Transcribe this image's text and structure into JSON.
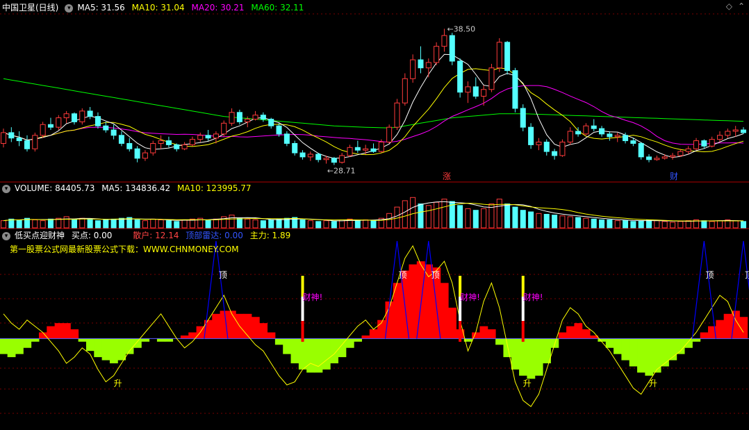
{
  "colors": {
    "background": "#000000",
    "up": "#ff3b3b",
    "down": "#54ffff",
    "ma5": "#ffffff",
    "ma10": "#ffff00",
    "ma20": "#ff00ff",
    "ma60": "#00ff00",
    "grid": "#7a0000",
    "pos_fill": "#ff0000",
    "neg_fill": "#99ff00",
    "yellow_line": "#ffff00",
    "blue_line": "#0000ff"
  },
  "price_panel": {
    "stock": "中国卫星(日线)",
    "ma5": "MA5: 31.56",
    "ma10": "MA10: 31.04",
    "ma20": "MA20: 30.21",
    "ma60": "MA60: 32.11",
    "high_label": "38.50",
    "low_label": "28.71",
    "zhang_marker": "涨",
    "cai_marker": "财",
    "toolbar_icons": [
      "diamond-icon",
      "collapse-icon"
    ]
  },
  "volume_panel": {
    "volume": "VOLUME: 84405.73",
    "ma5": "MA5: 134836.42",
    "ma10": "MA10: 123995.77"
  },
  "indicator_panel": {
    "name": "低买点迎财神",
    "buy": "买点: 0.00",
    "retail": "散户: 12.14",
    "radar": "顶部雷达: 0.00",
    "main_force": "主力: 1.89",
    "banner": "第一股票公式网最新股票公式下载：WWW.CHNMONEY.COM",
    "top_labels": [
      "顶",
      "顶",
      "顶",
      "顶",
      "顶",
      "顶"
    ],
    "caishen_labels": [
      "财神!",
      "财神!",
      "财神!"
    ],
    "sheng_labels": [
      "升",
      "升",
      "升"
    ]
  },
  "chart_data": {
    "type": "line",
    "candles_ohlc": [
      [
        30.0,
        31.1,
        29.7,
        30.8
      ],
      [
        30.8,
        31.2,
        30.1,
        30.4
      ],
      [
        30.4,
        30.9,
        29.8,
        30.2
      ],
      [
        30.2,
        30.6,
        29.4,
        29.6
      ],
      [
        29.6,
        30.8,
        29.4,
        30.6
      ],
      [
        30.6,
        31.6,
        30.4,
        31.4
      ],
      [
        31.4,
        31.9,
        31.0,
        31.2
      ],
      [
        31.2,
        32.1,
        31.0,
        31.9
      ],
      [
        31.9,
        32.4,
        31.5,
        32.2
      ],
      [
        32.2,
        32.3,
        31.4,
        31.6
      ],
      [
        31.6,
        32.6,
        31.4,
        32.4
      ],
      [
        32.4,
        32.7,
        31.8,
        32.0
      ],
      [
        32.0,
        32.3,
        31.1,
        31.3
      ],
      [
        31.3,
        31.6,
        30.8,
        31.0
      ],
      [
        31.0,
        31.4,
        30.3,
        30.6
      ],
      [
        30.6,
        30.9,
        29.8,
        30.0
      ],
      [
        30.0,
        30.4,
        29.4,
        29.6
      ],
      [
        29.6,
        29.8,
        28.6,
        28.9
      ],
      [
        28.9,
        29.5,
        28.7,
        29.3
      ],
      [
        29.3,
        30.2,
        29.1,
        30.0
      ],
      [
        30.0,
        30.6,
        29.6,
        30.2
      ],
      [
        30.2,
        30.5,
        29.7,
        29.9
      ],
      [
        29.9,
        30.0,
        29.4,
        29.6
      ],
      [
        29.6,
        30.1,
        29.5,
        29.9
      ],
      [
        29.9,
        30.5,
        29.8,
        30.3
      ],
      [
        30.3,
        30.8,
        30.1,
        30.6
      ],
      [
        30.6,
        31.0,
        30.2,
        30.4
      ],
      [
        30.4,
        30.9,
        30.0,
        30.7
      ],
      [
        30.7,
        31.7,
        30.5,
        31.5
      ],
      [
        31.5,
        32.6,
        31.3,
        32.3
      ],
      [
        32.3,
        32.5,
        31.4,
        31.6
      ],
      [
        31.6,
        32.0,
        31.2,
        31.8
      ],
      [
        31.8,
        32.4,
        31.7,
        32.1
      ],
      [
        32.1,
        32.3,
        31.6,
        31.8
      ],
      [
        31.8,
        31.9,
        31.1,
        31.3
      ],
      [
        31.3,
        31.5,
        30.5,
        30.7
      ],
      [
        30.7,
        30.9,
        29.8,
        30.0
      ],
      [
        30.0,
        30.2,
        29.1,
        29.3
      ],
      [
        29.3,
        29.5,
        28.8,
        29.0
      ],
      [
        29.0,
        29.4,
        28.7,
        29.2
      ],
      [
        29.2,
        29.3,
        28.6,
        28.8
      ],
      [
        28.8,
        29.1,
        28.5,
        28.9
      ],
      [
        28.9,
        29.0,
        28.4,
        28.6
      ],
      [
        28.6,
        29.3,
        28.5,
        29.1
      ],
      [
        29.1,
        29.9,
        29.0,
        29.7
      ],
      [
        29.7,
        30.2,
        29.3,
        29.5
      ],
      [
        29.5,
        29.9,
        29.2,
        29.6
      ],
      [
        29.6,
        30.0,
        29.3,
        29.4
      ],
      [
        29.4,
        30.3,
        29.3,
        30.1
      ],
      [
        30.1,
        31.4,
        30.0,
        31.2
      ],
      [
        31.2,
        33.3,
        31.0,
        33.0
      ],
      [
        33.0,
        35.2,
        32.8,
        34.8
      ],
      [
        34.8,
        36.6,
        34.5,
        36.2
      ],
      [
        36.2,
        37.2,
        35.2,
        35.6
      ],
      [
        35.6,
        36.3,
        34.9,
        36.0
      ],
      [
        36.0,
        37.5,
        35.8,
        37.2
      ],
      [
        37.2,
        38.5,
        36.8,
        38.0
      ],
      [
        38.0,
        38.2,
        35.8,
        36.1
      ],
      [
        36.1,
        36.3,
        33.4,
        33.8
      ],
      [
        33.8,
        34.6,
        33.0,
        34.2
      ],
      [
        34.2,
        34.9,
        33.3,
        33.5
      ],
      [
        33.5,
        34.3,
        32.8,
        34.0
      ],
      [
        34.0,
        35.9,
        33.8,
        35.6
      ],
      [
        35.6,
        37.8,
        35.3,
        37.5
      ],
      [
        37.5,
        37.6,
        35.1,
        35.4
      ],
      [
        35.4,
        35.6,
        32.3,
        32.6
      ],
      [
        32.6,
        32.9,
        30.9,
        31.2
      ],
      [
        31.2,
        31.5,
        29.6,
        29.9
      ],
      [
        29.9,
        30.4,
        29.5,
        30.1
      ],
      [
        30.1,
        30.3,
        29.1,
        29.4
      ],
      [
        29.4,
        29.6,
        28.8,
        29.1
      ],
      [
        29.1,
        30.3,
        29.0,
        30.1
      ],
      [
        30.1,
        31.2,
        29.9,
        30.9
      ],
      [
        30.9,
        31.2,
        30.5,
        30.7
      ],
      [
        30.7,
        31.5,
        30.6,
        31.3
      ],
      [
        31.3,
        31.8,
        30.9,
        31.1
      ],
      [
        31.1,
        31.3,
        30.5,
        30.7
      ],
      [
        30.7,
        30.9,
        30.2,
        30.5
      ],
      [
        30.5,
        30.8,
        30.1,
        30.6
      ],
      [
        30.6,
        30.8,
        30.0,
        30.2
      ],
      [
        30.2,
        30.4,
        29.8,
        30.0
      ],
      [
        30.0,
        30.1,
        28.8,
        29.0
      ],
      [
        29.0,
        29.2,
        28.6,
        28.8
      ],
      [
        28.8,
        29.1,
        28.71,
        28.9
      ],
      [
        28.9,
        29.2,
        28.8,
        29.0
      ],
      [
        29.0,
        29.3,
        28.8,
        29.1
      ],
      [
        29.1,
        29.6,
        29.0,
        29.4
      ],
      [
        29.4,
        29.8,
        29.2,
        29.6
      ],
      [
        29.6,
        30.4,
        29.5,
        30.2
      ],
      [
        30.2,
        30.3,
        29.6,
        29.8
      ],
      [
        29.8,
        30.5,
        29.7,
        30.3
      ],
      [
        30.3,
        30.9,
        30.1,
        30.6
      ],
      [
        30.6,
        31.1,
        30.4,
        30.9
      ],
      [
        30.9,
        31.3,
        30.5,
        31.0
      ],
      [
        31.0,
        31.2,
        30.7,
        30.8
      ]
    ],
    "ma60_line": [
      34.8,
      34.7,
      34.6,
      34.5,
      34.4,
      34.3,
      34.2,
      34.1,
      34.0,
      33.9,
      33.8,
      33.7,
      33.6,
      33.5,
      33.4,
      33.3,
      33.2,
      33.1,
      33.0,
      32.9,
      32.8,
      32.7,
      32.6,
      32.5,
      32.4,
      32.3,
      32.2,
      32.1,
      32.0,
      31.95,
      31.9,
      31.85,
      31.8,
      31.75,
      31.7,
      31.65,
      31.6,
      31.55,
      31.5,
      31.45,
      31.4,
      31.35,
      31.3,
      31.27,
      31.25,
      31.22,
      31.2,
      31.18,
      31.16,
      31.15,
      31.2,
      31.3,
      31.4,
      31.5,
      31.6,
      31.7,
      31.8,
      31.9,
      31.95,
      32.0,
      32.05,
      32.1,
      32.15,
      32.2,
      32.2,
      32.2,
      32.2,
      32.18,
      32.16,
      32.14,
      32.12,
      32.1,
      32.08,
      32.06,
      32.04,
      32.02,
      32.0,
      31.98,
      31.96,
      31.94,
      31.92,
      31.9,
      31.88,
      31.86,
      31.84,
      31.82,
      31.8,
      31.78,
      31.76,
      31.74,
      31.72,
      31.7,
      31.68,
      31.66,
      31.64
    ],
    "volume": [
      9,
      11,
      10,
      12,
      10,
      9,
      11,
      12,
      14,
      10,
      12,
      11,
      9,
      10,
      11,
      12,
      13,
      10,
      9,
      11,
      10,
      9,
      8,
      10,
      11,
      12,
      10,
      11,
      14,
      16,
      12,
      11,
      10,
      9,
      10,
      11,
      12,
      13,
      10,
      9,
      8,
      9,
      8,
      10,
      11,
      9,
      10,
      9,
      12,
      18,
      26,
      34,
      38,
      30,
      28,
      32,
      36,
      33,
      28,
      24,
      22,
      24,
      30,
      36,
      30,
      26,
      22,
      20,
      18,
      17,
      16,
      15,
      14,
      13,
      12,
      11,
      10,
      10,
      9,
      9,
      8,
      9,
      10,
      9,
      8,
      7,
      8,
      9,
      10,
      9,
      8,
      9,
      10,
      9,
      8
    ],
    "main_force": [
      -5,
      -6,
      -5,
      -3,
      -1,
      2,
      4,
      5,
      5,
      3,
      -1,
      -4,
      -6,
      -7,
      -8,
      -7,
      -5,
      -3,
      -1,
      0,
      -1,
      -1,
      0,
      1,
      2,
      4,
      6,
      8,
      9,
      9,
      8,
      8,
      7,
      5,
      2,
      -2,
      -5,
      -8,
      -10,
      -11,
      -11,
      -10,
      -8,
      -6,
      -3,
      -1,
      1,
      3,
      6,
      12,
      18,
      22,
      24,
      25,
      24,
      23,
      18,
      10,
      3,
      -1,
      2,
      4,
      3,
      -2,
      -6,
      -10,
      -12,
      -13,
      -12,
      -8,
      -3,
      2,
      4,
      5,
      3,
      1,
      -1,
      -3,
      -5,
      -7,
      -9,
      -11,
      -12,
      -11,
      -9,
      -7,
      -5,
      -3,
      -1,
      2,
      4,
      6,
      8,
      9,
      7
    ],
    "yellow_line": [
      8,
      5,
      3,
      6,
      4,
      2,
      -1,
      -4,
      -8,
      -6,
      -3,
      -5,
      -10,
      -14,
      -12,
      -8,
      -4,
      -1,
      2,
      5,
      8,
      4,
      0,
      -3,
      -1,
      2,
      6,
      10,
      14,
      8,
      4,
      1,
      -2,
      -4,
      -8,
      -12,
      -15,
      -14,
      -10,
      -8,
      -9,
      -7,
      -5,
      -2,
      1,
      4,
      6,
      3,
      5,
      10,
      18,
      26,
      30,
      24,
      20,
      22,
      25,
      18,
      6,
      -4,
      2,
      12,
      18,
      10,
      -2,
      -14,
      -20,
      -22,
      -18,
      -10,
      -2,
      6,
      10,
      8,
      4,
      2,
      -1,
      -4,
      -8,
      -12,
      -16,
      -18,
      -14,
      -10,
      -8,
      -6,
      -4,
      -1,
      2,
      6,
      10,
      14,
      12,
      6,
      2
    ],
    "ylim_price": [
      27.5,
      39.5
    ],
    "ylim_indicator": [
      -28,
      32
    ]
  }
}
